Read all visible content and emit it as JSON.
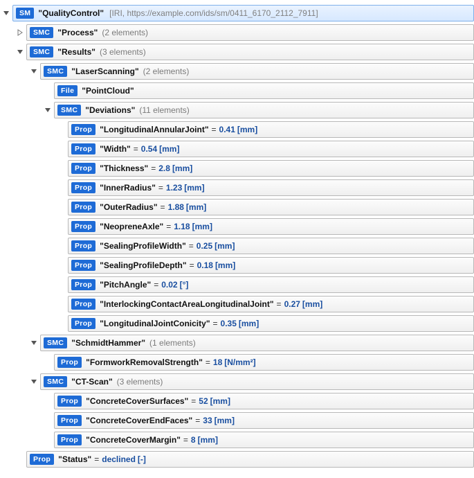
{
  "root": {
    "tag": "SM",
    "name": "QualityControl",
    "iri_label": "IRI",
    "iri": "https://example.com/ids/sm/0411_6170_2112_7911"
  },
  "process": {
    "tag": "SMC",
    "name": "Process",
    "count": "(2 elements)"
  },
  "results": {
    "tag": "SMC",
    "name": "Results",
    "count": "(3 elements)"
  },
  "laser": {
    "tag": "SMC",
    "name": "LaserScanning",
    "count": "(2 elements)"
  },
  "pointcloud": {
    "tag": "File",
    "name": "PointCloud"
  },
  "deviations": {
    "tag": "SMC",
    "name": "Deviations",
    "count": "(11 elements)"
  },
  "props": {
    "laj": {
      "tag": "Prop",
      "name": "LongitudinalAnnularJoint",
      "value": "0.41",
      "unit": "[mm]"
    },
    "width": {
      "tag": "Prop",
      "name": "Width",
      "value": "0.54",
      "unit": "[mm]"
    },
    "thick": {
      "tag": "Prop",
      "name": "Thickness",
      "value": "2.8",
      "unit": "[mm]"
    },
    "inrad": {
      "tag": "Prop",
      "name": "InnerRadius",
      "value": "1.23",
      "unit": "[mm]"
    },
    "outrad": {
      "tag": "Prop",
      "name": "OuterRadius",
      "value": "1.88",
      "unit": "[mm]"
    },
    "neo": {
      "tag": "Prop",
      "name": "NeopreneAxle",
      "value": "1.18",
      "unit": "[mm]"
    },
    "spw": {
      "tag": "Prop",
      "name": "SealingProfileWidth",
      "value": "0.25",
      "unit": "[mm]"
    },
    "spd": {
      "tag": "Prop",
      "name": "SealingProfileDepth",
      "value": "0.18",
      "unit": "[mm]"
    },
    "pitch": {
      "tag": "Prop",
      "name": "PitchAngle",
      "value": "0.02",
      "unit": "[°]"
    },
    "inter": {
      "tag": "Prop",
      "name": "InterlockingContactAreaLongitudinalJoint",
      "value": "0.27",
      "unit": "[mm]"
    },
    "ljc": {
      "tag": "Prop",
      "name": "LongitudinalJointConicity",
      "value": "0.35",
      "unit": "[mm]"
    }
  },
  "schmidt": {
    "tag": "SMC",
    "name": "SchmidtHammer",
    "count": "(1 elements)"
  },
  "frs": {
    "tag": "Prop",
    "name": "FormworkRemovalStrength",
    "value": "18",
    "unit": "[N/mm²]"
  },
  "ctscan": {
    "tag": "SMC",
    "name": "CT-Scan",
    "count": "(3 elements)"
  },
  "ccs": {
    "tag": "Prop",
    "name": "ConcreteCoverSurfaces",
    "value": "52",
    "unit": "[mm]"
  },
  "cce": {
    "tag": "Prop",
    "name": "ConcreteCoverEndFaces",
    "value": "33",
    "unit": "[mm]"
  },
  "ccm": {
    "tag": "Prop",
    "name": "ConcreteCoverMargin",
    "value": "8",
    "unit": "[mm]"
  },
  "status": {
    "tag": "Prop",
    "name": "Status",
    "value": "declined",
    "unit": "[-]"
  }
}
